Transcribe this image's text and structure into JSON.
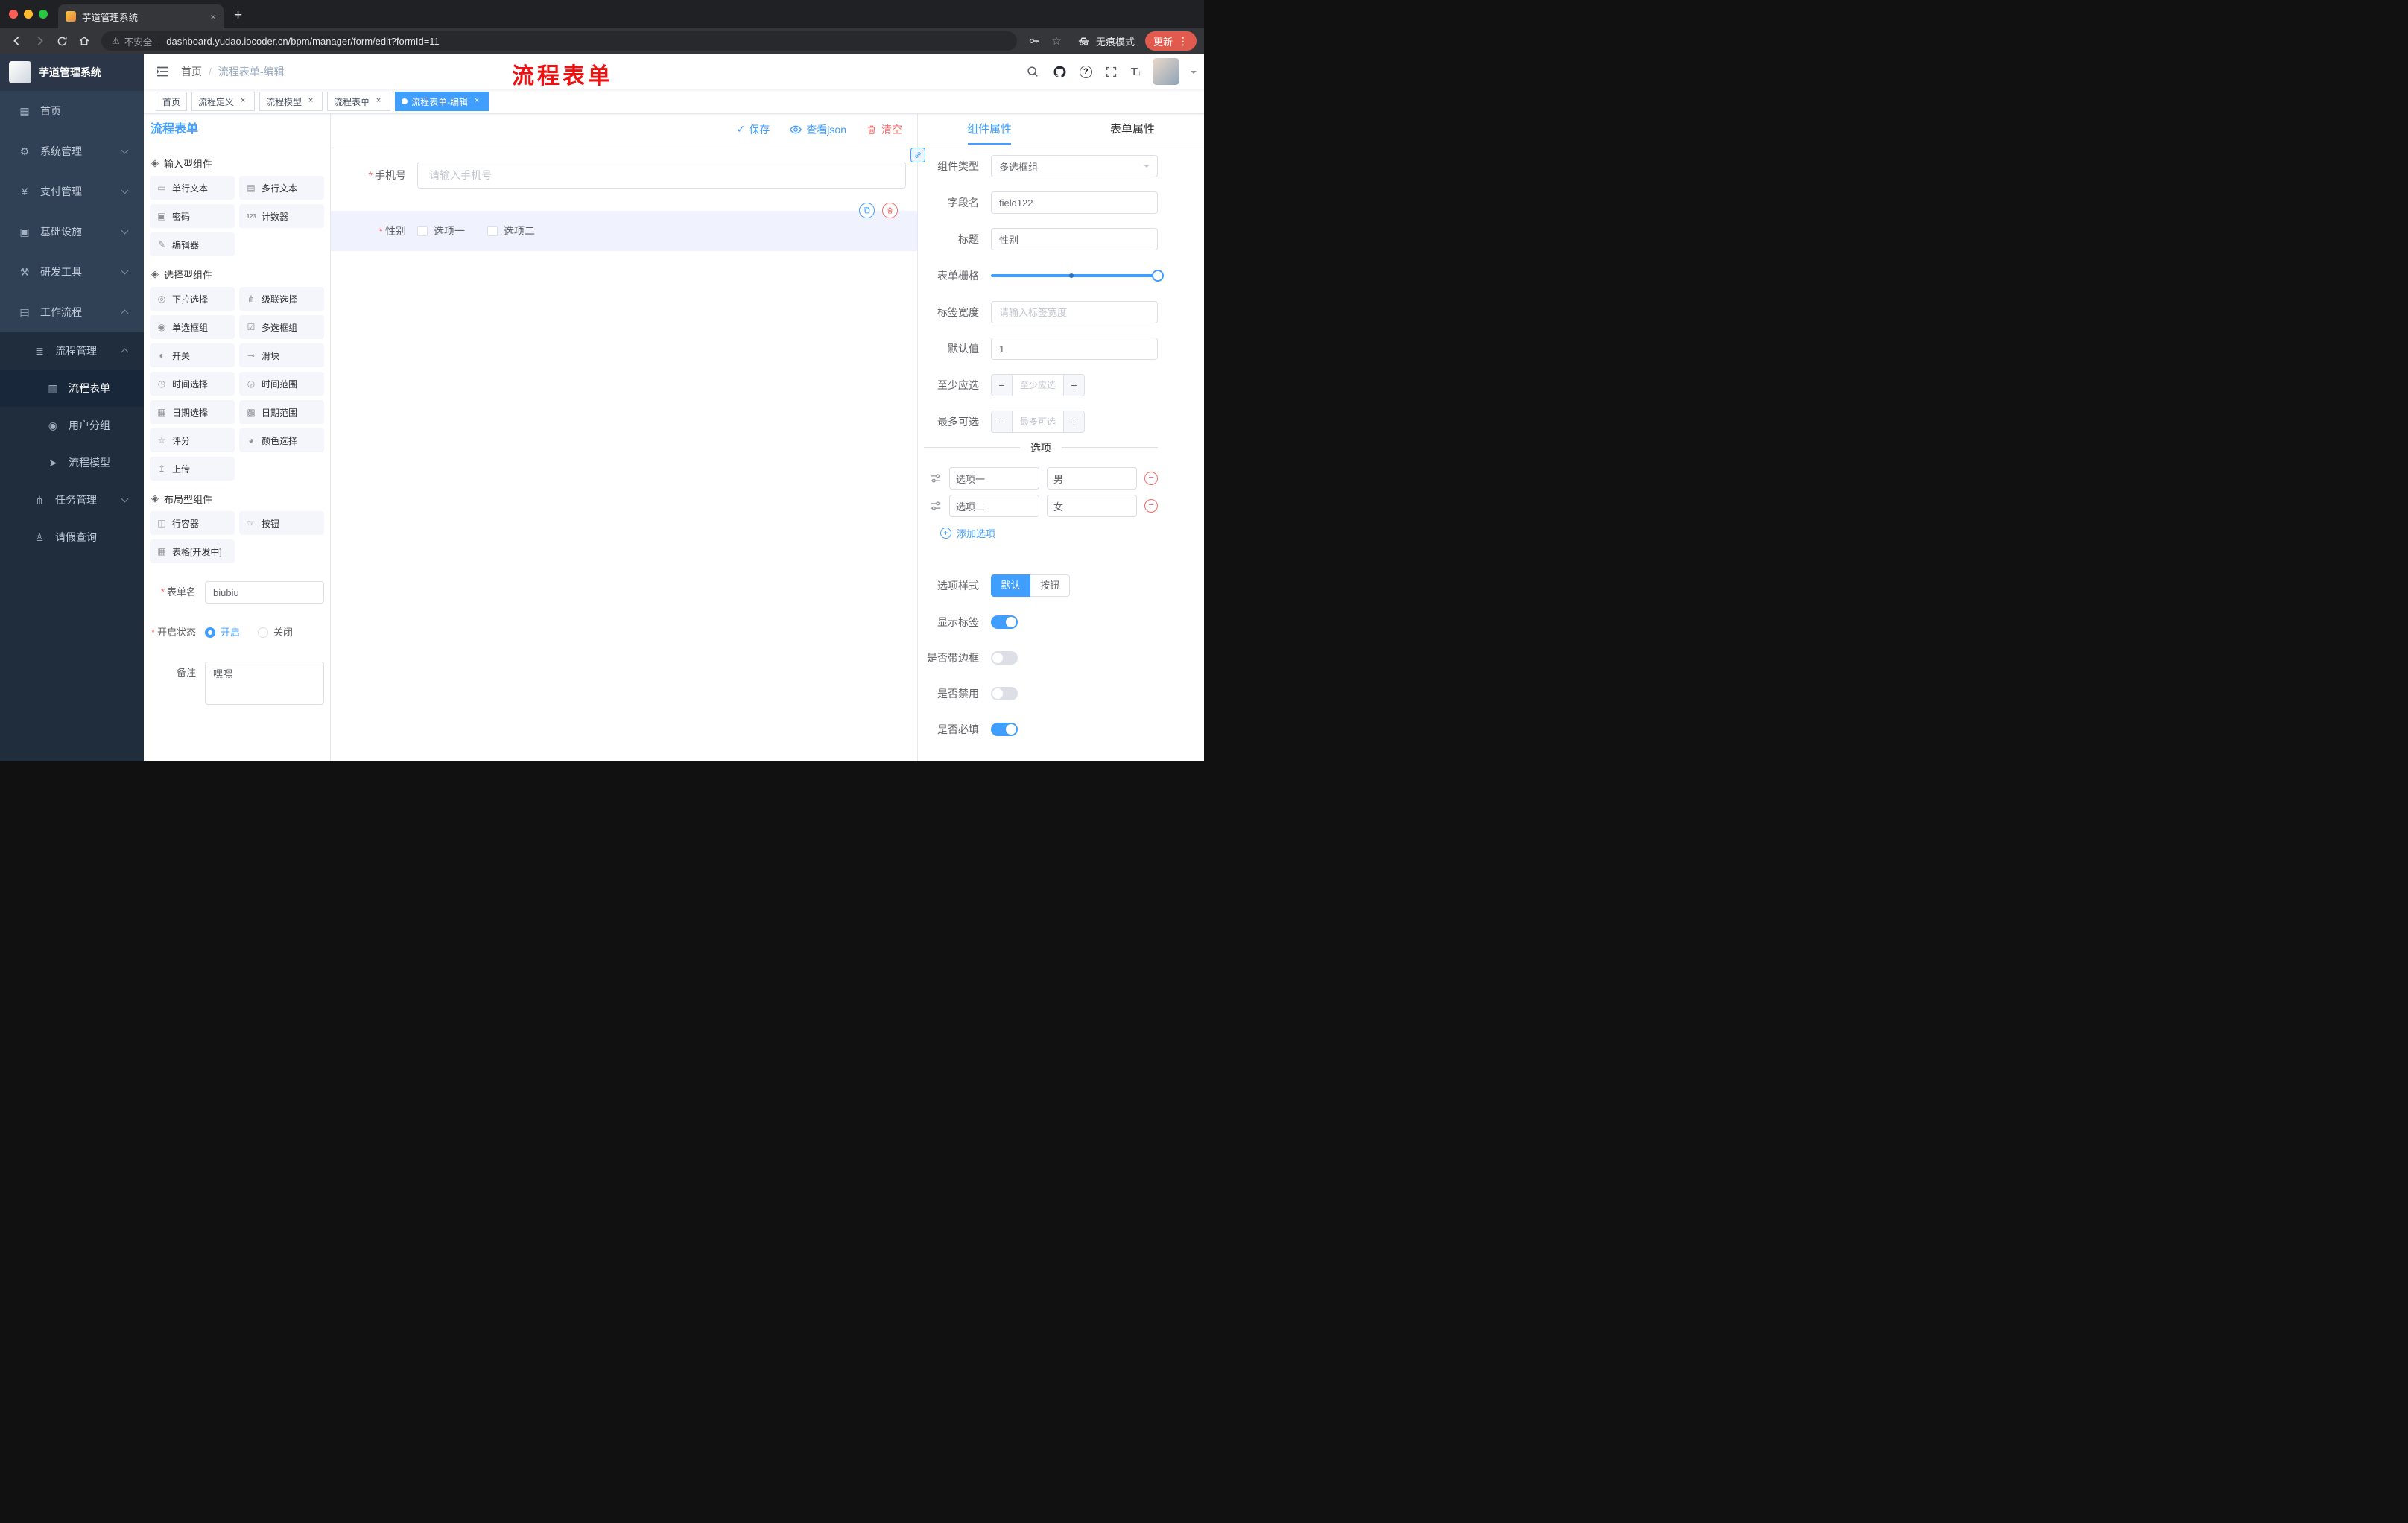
{
  "browser": {
    "tab_title": "芋道管理系统",
    "security_label": "不安全",
    "url": "dashboard.yudao.iocoder.cn/bpm/manager/form/edit?formId=11",
    "incognito_label": "无痕模式",
    "update_label": "更新"
  },
  "header": {
    "breadcrumb": [
      "首页",
      "流程表单-编辑"
    ],
    "annotation": "流程表单"
  },
  "tags": [
    {
      "label": "首页",
      "closable": false,
      "active": false
    },
    {
      "label": "流程定义",
      "closable": true,
      "active": false
    },
    {
      "label": "流程模型",
      "closable": true,
      "active": false
    },
    {
      "label": "流程表单",
      "closable": true,
      "active": false
    },
    {
      "label": "流程表单-编辑",
      "closable": true,
      "active": true
    }
  ],
  "sidebar": {
    "logo_title": "芋道管理系统",
    "menu": [
      {
        "label": "首页",
        "glyph": "▦"
      },
      {
        "label": "系统管理",
        "glyph": "⚙"
      },
      {
        "label": "支付管理",
        "glyph": "¥"
      },
      {
        "label": "基础设施",
        "glyph": "▣"
      },
      {
        "label": "研发工具",
        "glyph": "⚒"
      },
      {
        "label": "工作流程",
        "glyph": "▤"
      },
      {
        "label": "流程管理",
        "glyph": "≣"
      },
      {
        "label": "流程表单",
        "glyph": "▥"
      },
      {
        "label": "用户分组",
        "glyph": "◉"
      },
      {
        "label": "流程模型",
        "glyph": "➤"
      },
      {
        "label": "任务管理",
        "glyph": "⋔"
      },
      {
        "label": "请假查询",
        "glyph": "♙"
      }
    ]
  },
  "designer": {
    "title": "流程表单",
    "actions": {
      "save": "保存",
      "view_json": "查看json",
      "clear": "清空"
    }
  },
  "palette": {
    "sections": [
      {
        "title": "输入型组件",
        "items": [
          {
            "label": "单行文本",
            "glyph": "▭"
          },
          {
            "label": "多行文本",
            "glyph": "▤"
          },
          {
            "label": "密码",
            "glyph": "▣"
          },
          {
            "label": "计数器",
            "glyph": "123"
          },
          {
            "label": "编辑器",
            "glyph": "✎"
          }
        ]
      },
      {
        "title": "选择型组件",
        "items": [
          {
            "label": "下拉选择",
            "glyph": "◎"
          },
          {
            "label": "级联选择",
            "glyph": "⋔"
          },
          {
            "label": "单选框组",
            "glyph": "◉"
          },
          {
            "label": "多选框组",
            "glyph": "☑"
          },
          {
            "label": "开关",
            "glyph": "◐"
          },
          {
            "label": "滑块",
            "glyph": "⊸"
          },
          {
            "label": "时间选择",
            "glyph": "◷"
          },
          {
            "label": "时间范围",
            "glyph": "◶"
          },
          {
            "label": "日期选择",
            "glyph": "▦"
          },
          {
            "label": "日期范围",
            "glyph": "▩"
          },
          {
            "label": "评分",
            "glyph": "☆"
          },
          {
            "label": "颜色选择",
            "glyph": "◕"
          },
          {
            "label": "上传",
            "glyph": "↥"
          }
        ]
      },
      {
        "title": "布局型组件",
        "items": [
          {
            "label": "行容器",
            "glyph": "◫"
          },
          {
            "label": "按钮",
            "glyph": "☞"
          },
          {
            "label": "表格[开发中]",
            "glyph": "▦"
          }
        ]
      }
    ]
  },
  "meta_form": {
    "form_name": {
      "label": "表单名",
      "value": "biubiu"
    },
    "status": {
      "label": "开启状态",
      "on_label": "开启",
      "off_label": "关闭",
      "selected": "开启"
    },
    "remark": {
      "label": "备注",
      "value": "嘿嘿"
    }
  },
  "canvas": {
    "phone": {
      "label": "手机号",
      "placeholder": "请输入手机号",
      "required": true
    },
    "gender": {
      "label": "性别",
      "required": true,
      "options": [
        "选项一",
        "选项二"
      ]
    }
  },
  "props": {
    "tabs": [
      "组件属性",
      "表单属性"
    ],
    "component_type": {
      "label": "组件类型",
      "value": "多选框组"
    },
    "field_name": {
      "label": "字段名",
      "value": "field122"
    },
    "title": {
      "label": "标题",
      "value": "性别"
    },
    "grid": {
      "label": "表单栅格"
    },
    "label_width": {
      "label": "标签宽度",
      "placeholder": "请输入标签宽度"
    },
    "default_value": {
      "label": "默认值",
      "value": "1"
    },
    "min_select": {
      "label": "至少应选",
      "placeholder": "至少应选"
    },
    "max_select": {
      "label": "最多可选",
      "placeholder": "最多可选"
    },
    "options_title": "选项",
    "options": [
      {
        "label": "选项一",
        "value": "男"
      },
      {
        "label": "选项二",
        "value": "女"
      }
    ],
    "add_option": "添加选项",
    "style": {
      "label": "选项样式",
      "default": "默认",
      "button": "按钮"
    },
    "toggles": [
      {
        "label": "显示标签",
        "on": true
      },
      {
        "label": "是否带边框",
        "on": false
      },
      {
        "label": "是否禁用",
        "on": false
      },
      {
        "label": "是否必填",
        "on": true
      }
    ]
  },
  "colors": {
    "primary": "#409EFF",
    "danger": "#F56C6C",
    "annotation_red": "#EE1111"
  }
}
